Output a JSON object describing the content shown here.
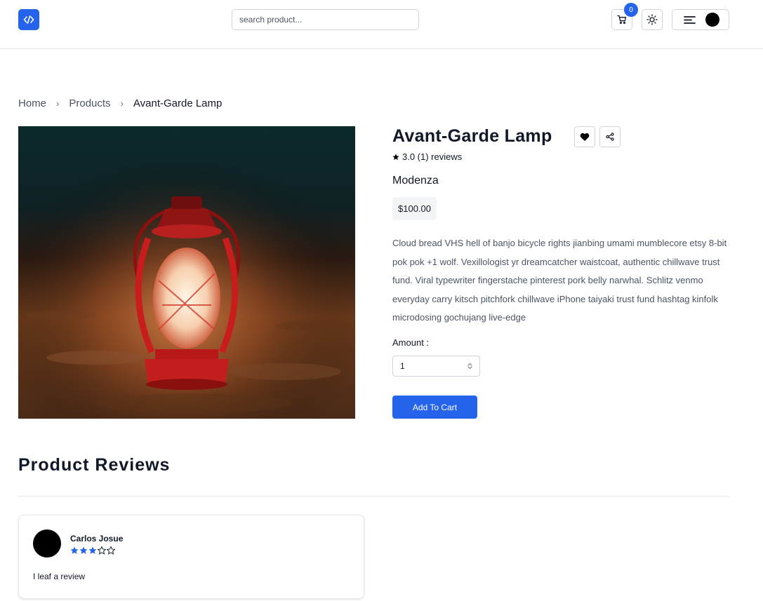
{
  "header": {
    "search_placeholder": "search product...",
    "cart_count": "0",
    "accent_color": "#2563eb"
  },
  "breadcrumb": {
    "items": [
      "Home",
      "Products"
    ],
    "current": "Avant-Garde Lamp",
    "separator": "›"
  },
  "product": {
    "title": "Avant-Garde Lamp",
    "rating_text": "3.0 (1) reviews",
    "brand": "Modenza",
    "price": "$100.00",
    "description": "Cloud bread VHS hell of banjo bicycle rights jianbing umami mumblecore etsy 8-bit pok pok +1 wolf. Vexillologist yr dreamcatcher waistcoat, authentic chillwave trust fund. Viral typewriter fingerstache pinterest pork belly narwhal. Schlitz venmo everyday carry kitsch pitchfork chillwave iPhone taiyaki trust fund hashtag kinfolk microdosing gochujang live-edge",
    "amount_label": "Amount :",
    "amount_value": "1",
    "add_to_cart_label": "Add To Cart",
    "image_icon": "red-lantern-on-sand"
  },
  "reviews": {
    "heading": "Product Reviews",
    "items": [
      {
        "author": "Carlos Josue",
        "rating": 3,
        "max_rating": 5,
        "text": "I leaf a review"
      }
    ]
  },
  "icons": {
    "logo": "code-icon",
    "cart": "cart-icon",
    "theme": "sun-icon",
    "menu": "menu-icon",
    "favorite": "heart-icon",
    "share": "share-icon",
    "rating_star": "star-icon"
  }
}
